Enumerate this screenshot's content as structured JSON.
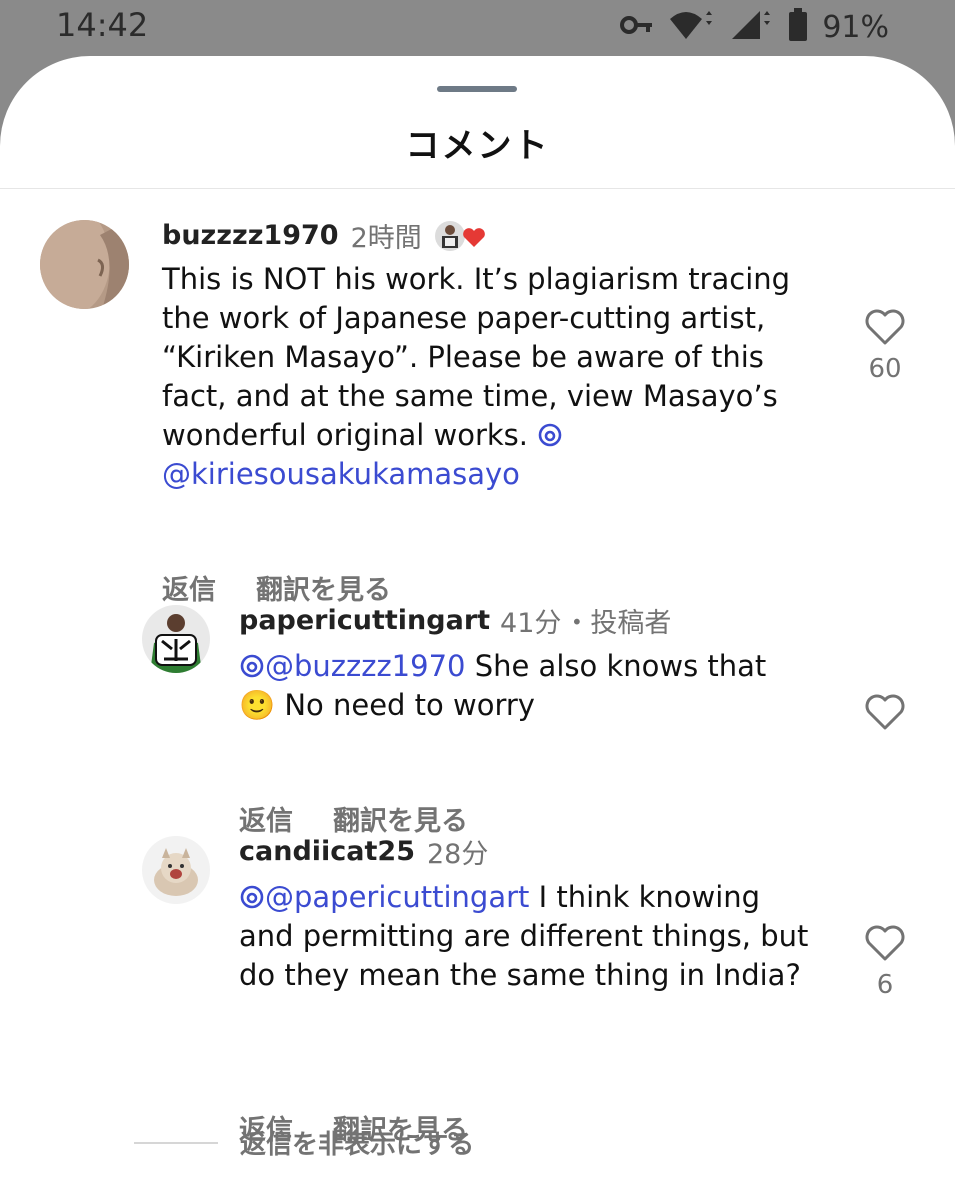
{
  "status_bar": {
    "time": "14:42",
    "battery": "91%"
  },
  "sheet": {
    "title": "コメント"
  },
  "comments": [
    {
      "username": "buzzzz1970",
      "time": "2時間",
      "text": "This is NOT his work. It’s plagiarism tracing the work of Japanese paper-cutting artist, “Kiriken Masayo”. Please be aware of this fact, and at the same time, view Masayo’s wonderful original works.",
      "mention": "@kiriesousakukamasayo",
      "reply_label": "返信",
      "translate_label": "翻訳を見る",
      "likes": "60"
    },
    {
      "username": "papericuttingart",
      "time": "41分",
      "author_tag": "・投稿者",
      "mention": "@buzzzz1970",
      "text": "She also knows that",
      "text2": "🙂 No need to worry",
      "reply_label": "返信",
      "translate_label": "翻訳を見る"
    },
    {
      "username": "candiicat25",
      "time": "28分",
      "mention": "@papericuttingart",
      "text": "I think knowing and permitting are different things, but do they mean the same thing in India?",
      "reply_label": "返信",
      "translate_label": "翻訳を見る",
      "likes": "6"
    }
  ],
  "hide_replies_label": "返信を非表示にする",
  "colors": {
    "mention": "#3b4bd1",
    "heart_reaction": "#e53935",
    "meta": "#737373"
  },
  "icons": [
    "key-icon",
    "wifi-icon",
    "signal-icon",
    "battery-icon",
    "heart-icon",
    "threads-icon"
  ]
}
